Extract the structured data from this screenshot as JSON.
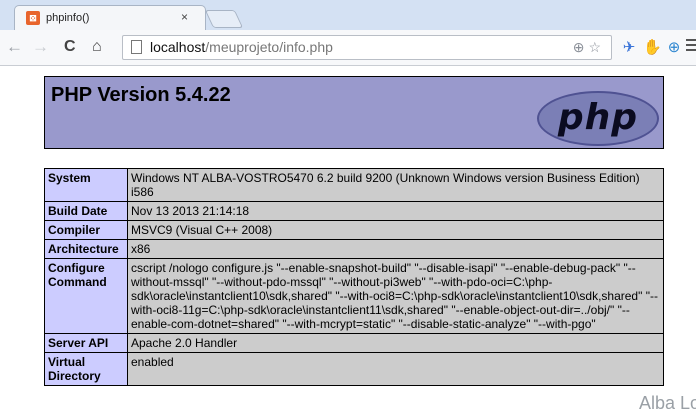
{
  "browser": {
    "tab": {
      "favicon": "php-favicon-icon",
      "title": "phpinfo()",
      "close": "×"
    },
    "toolbar": {
      "back": "←",
      "forward": "→",
      "reload": "C",
      "home": "⌂",
      "url_host": "localhost",
      "url_path": "/meuprojeto/info.php",
      "extensions": [
        "✈",
        "✋",
        "⊕"
      ]
    }
  },
  "page": {
    "header": {
      "version": "PHP Version 5.4.22",
      "logo": "php"
    },
    "rows": [
      {
        "key": "System",
        "value": "Windows NT ALBA-VOSTRO5470 6.2 build 9200 (Unknown Windows version Business Edition) i586"
      },
      {
        "key": "Build Date",
        "value": "Nov 13 2013 21:14:18"
      },
      {
        "key": "Compiler",
        "value": "MSVC9 (Visual C++ 2008)"
      },
      {
        "key": "Architecture",
        "value": "x86"
      },
      {
        "key": "Configure Command",
        "value": "cscript /nologo configure.js \"--enable-snapshot-build\" \"--disable-isapi\" \"--enable-debug-pack\" \"--without-mssql\" \"--without-pdo-mssql\" \"--without-pi3web\" \"--with-pdo-oci=C:\\php-sdk\\oracle\\instantclient10\\sdk,shared\" \"--with-oci8=C:\\php-sdk\\oracle\\instantclient10\\sdk,shared\" \"--with-oci8-11g=C:\\php-sdk\\oracle\\instantclient11\\sdk,shared\" \"--enable-object-out-dir=../obj/\" \"--enable-com-dotnet=shared\" \"--with-mcrypt=static\" \"--disable-static-analyze\" \"--with-pgo\""
      },
      {
        "key": "Server API",
        "value": "Apache 2.0 Handler"
      },
      {
        "key": "Virtual Directory",
        "value": "enabled"
      }
    ],
    "watermark": "Alba Lo"
  }
}
